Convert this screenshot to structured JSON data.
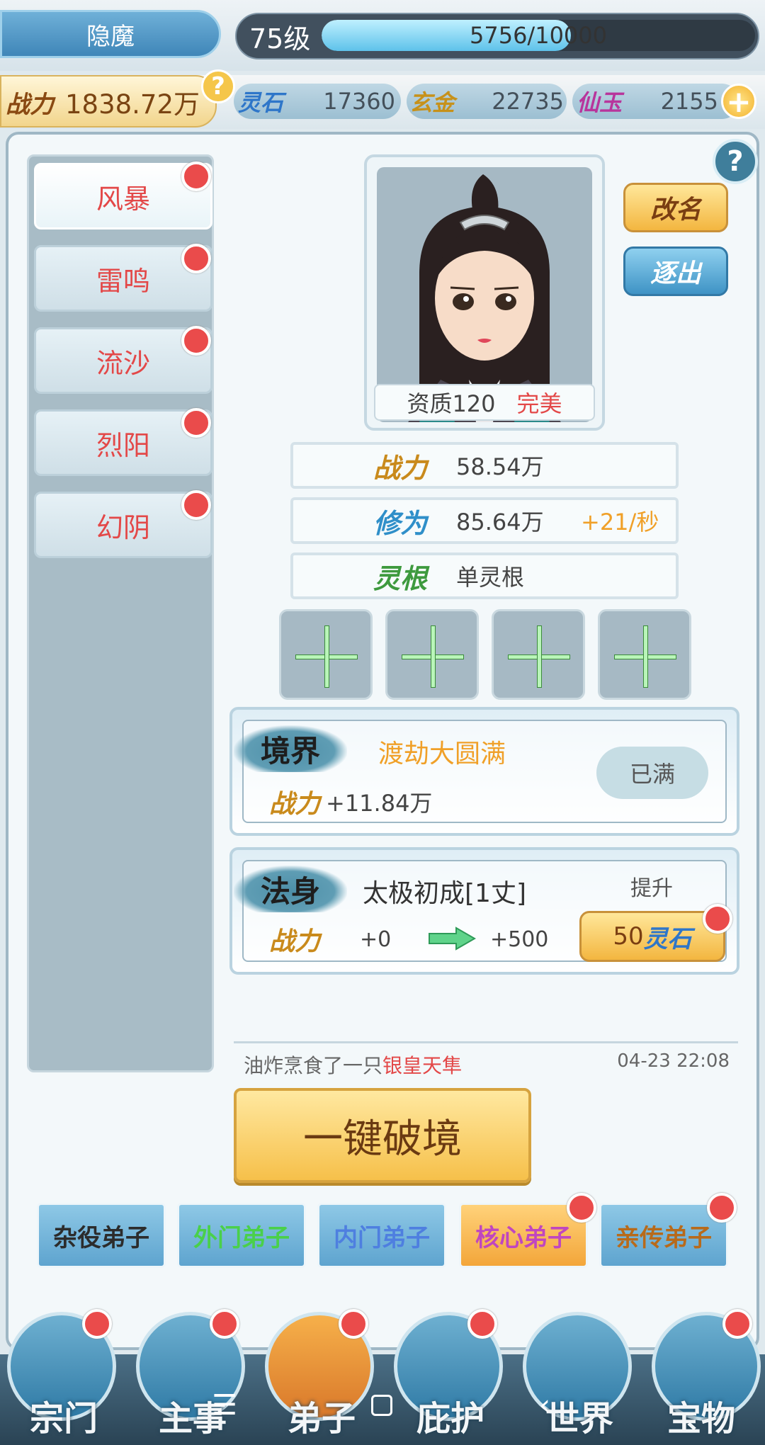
{
  "header": {
    "sect_name": "隐魔",
    "level": "75级",
    "exp_current": 5756,
    "exp_max": 10000,
    "exp_text": "5756/10000"
  },
  "resources": {
    "power_label": "战力",
    "power_value": "1838.72万",
    "items": [
      {
        "label": "灵石",
        "value": "17360",
        "color": "#2e76c9"
      },
      {
        "label": "玄金",
        "value": "22735",
        "color": "#c7911a"
      },
      {
        "label": "仙玉",
        "value": "2155",
        "color": "#b8359c"
      }
    ]
  },
  "help_icon": "question-icon",
  "tabs": [
    {
      "label": "风暴",
      "active": true
    },
    {
      "label": "雷鸣",
      "active": false
    },
    {
      "label": "流沙",
      "active": false
    },
    {
      "label": "烈阳",
      "active": false
    },
    {
      "label": "幻阴",
      "active": false
    }
  ],
  "disciple": {
    "aptitude_label": "资质120",
    "aptitude_grade": "完美",
    "rename_label": "改名",
    "expel_label": "逐出",
    "stats": [
      {
        "label": "战力",
        "value": "58.54万",
        "extra": "",
        "label_color": "#c98a1c"
      },
      {
        "label": "修为",
        "value": "85.64万",
        "extra": "+21/秒",
        "label_color": "#2f8fc9"
      },
      {
        "label": "灵根",
        "value": "单灵根",
        "extra": "",
        "label_color": "#3e9a3e"
      }
    ]
  },
  "realm": {
    "title": "境界",
    "name": "渡劫大圆满",
    "power_label": "战力",
    "power_bonus": "+11.84万",
    "status": "已满"
  },
  "dharma": {
    "title": "法身",
    "name": "太极初成[1丈]",
    "upgrade_label": "提升",
    "power_label": "战力",
    "current": "+0",
    "next": "+500",
    "cost_amount": "50",
    "cost_unit": "灵石"
  },
  "log": {
    "text_prefix": "油炸烹食了一只",
    "text_item": "银皇天隼",
    "time": "04-23 22:08"
  },
  "break_button": "一键破境",
  "disciple_types": [
    {
      "label": "杂役弟子",
      "color": "#2c2c2c",
      "style": "blue",
      "badge": false
    },
    {
      "label": "外门弟子",
      "color": "#4ad04a",
      "style": "blue",
      "badge": false
    },
    {
      "label": "内门弟子",
      "color": "#4e7fe0",
      "style": "blue",
      "badge": false
    },
    {
      "label": "核心弟子",
      "color": "#c046c0",
      "style": "orange",
      "badge": true
    },
    {
      "label": "亲传弟子",
      "color": "#b86a1a",
      "style": "blue",
      "badge": true
    }
  ],
  "nav": [
    {
      "label": "宗门",
      "icon": "sect-icon"
    },
    {
      "label": "主事",
      "icon": "checklist-icon"
    },
    {
      "label": "弟子",
      "icon": "disciple-icon"
    },
    {
      "label": "庇护",
      "icon": "guardian-beast-icon"
    },
    {
      "label": "世界",
      "icon": "world-scroll-icon"
    },
    {
      "label": "宝物",
      "icon": "treasure-icon"
    }
  ]
}
